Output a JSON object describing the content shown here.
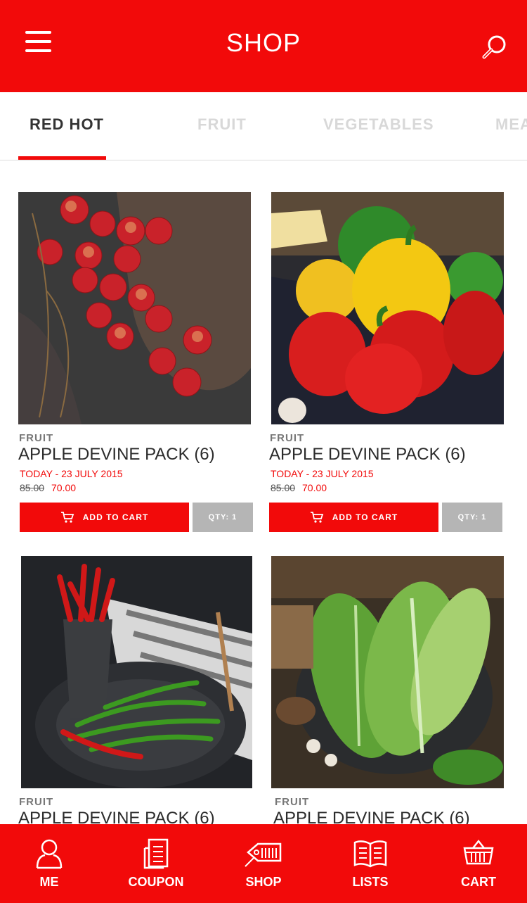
{
  "header": {
    "title": "SHOP",
    "menu_icon": "hamburger-menu-icon",
    "search_icon": "search-icon",
    "background_color": "#f20a0a"
  },
  "tabs": [
    {
      "label": "RED HOT",
      "active": true
    },
    {
      "label": "FRUIT",
      "active": false
    },
    {
      "label": "VEGETABLES",
      "active": false
    },
    {
      "label": "MEA",
      "active": false
    }
  ],
  "products": [
    {
      "image": "apples-photo",
      "category": "FRUIT",
      "name": "APPLE DEVINE PACK (6)",
      "date": "TODAY - 23 JULY 2015",
      "old_price": "85.00",
      "new_price": "70.00",
      "add_label": "ADD TO CART",
      "qty_label": "QTY: 1"
    },
    {
      "image": "bell-peppers-photo",
      "category": "FRUIT",
      "name": "APPLE DEVINE PACK (6)",
      "date": "TODAY - 23 JULY 2015",
      "old_price": "85.00",
      "new_price": "70.00",
      "add_label": "ADD TO CART",
      "qty_label": "QTY: 1"
    },
    {
      "image": "chili-peppers-photo",
      "category": "FRUIT",
      "name": "APPLE DEVINE PACK (6)"
    },
    {
      "image": "romaine-lettuce-photo",
      "category": "FRUIT",
      "name": "APPLE DEVINE PACK (6)"
    }
  ],
  "bottom_nav": [
    {
      "label": "ME",
      "icon": "user-icon"
    },
    {
      "label": "COUPON",
      "icon": "coupon-document-icon"
    },
    {
      "label": "SHOP",
      "icon": "price-tag-icon"
    },
    {
      "label": "LISTS",
      "icon": "open-book-icon"
    },
    {
      "label": "CART",
      "icon": "shopping-basket-icon"
    }
  ],
  "colors": {
    "accent": "#f20a0a",
    "qty_button": "#b5b5b5",
    "tab_inactive": "#d8d8d8"
  }
}
